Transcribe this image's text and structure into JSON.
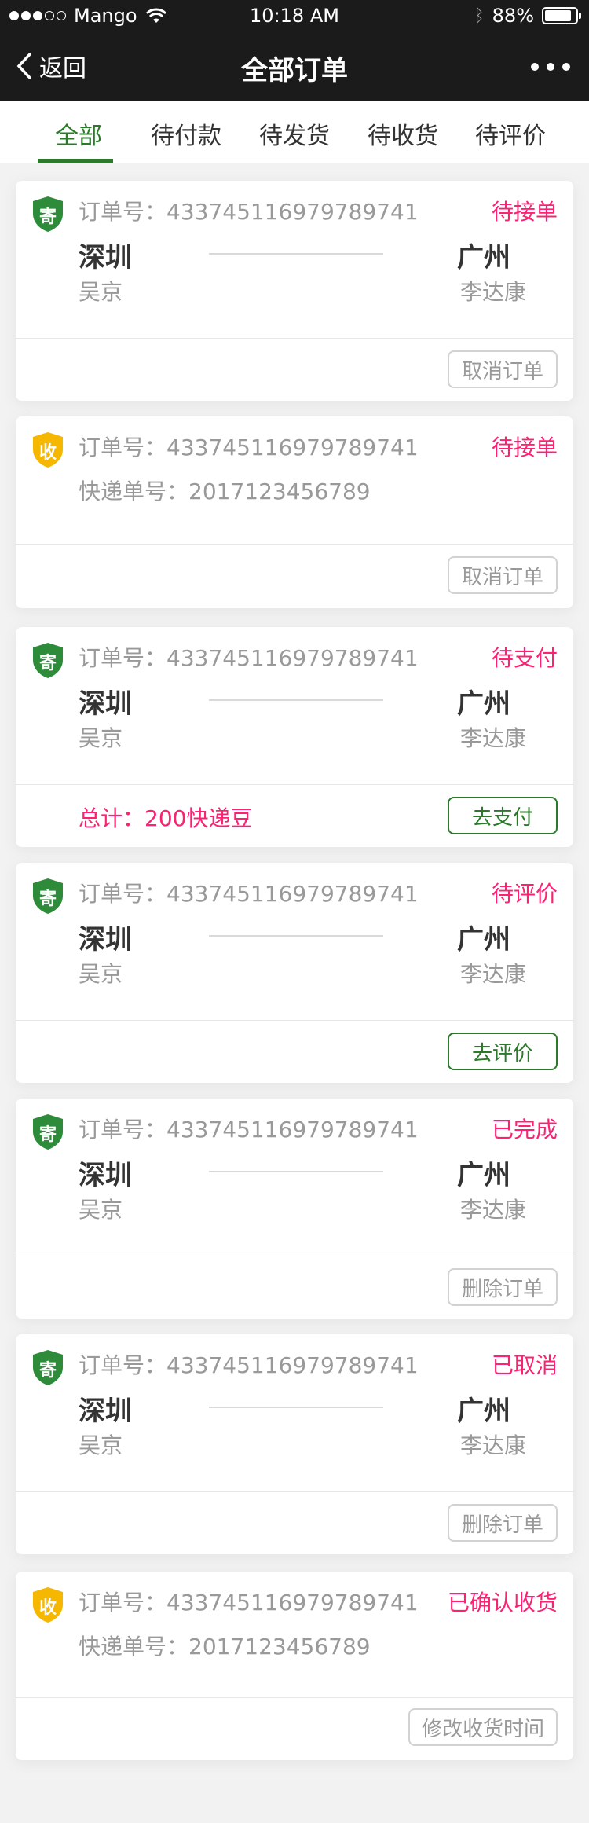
{
  "statusbar": {
    "carrier": "Mango",
    "time": "10:18 AM",
    "battery": "88%",
    "battery_level": 0.88,
    "bluetooth_icon": "bluetooth-icon"
  },
  "navbar": {
    "back_label": "返回",
    "title": "全部订单"
  },
  "tabs": [
    {
      "label": "全部",
      "active": true
    },
    {
      "label": "待付款"
    },
    {
      "label": "待发货"
    },
    {
      "label": "待收货"
    },
    {
      "label": "待评价"
    }
  ],
  "colors": {
    "accent_green": "#2a7a2a",
    "status_pink": "#FD2073",
    "badge_green": "#2e8b3a",
    "badge_yellow": "#f5b700"
  },
  "orders": [
    {
      "badge": "寄",
      "order_no": "订单号：433745116979789741",
      "status": "待接单",
      "from_city": "深圳",
      "from_name": "吴京",
      "to_city": "广州",
      "to_name": "李达康",
      "button": "取消订单"
    },
    {
      "badge": "收",
      "order_no": "订单号：433745116979789741",
      "status": "待接单",
      "express_no": "快递单号：2017123456789",
      "button": "取消订单"
    },
    {
      "badge": "寄",
      "order_no": "订单号：433745116979789741",
      "status": "待支付",
      "from_city": "深圳",
      "from_name": "吴京",
      "to_city": "广州",
      "to_name": "李达康",
      "total": "总计：200快递豆",
      "button": "去支付"
    },
    {
      "badge": "寄",
      "order_no": "订单号：433745116979789741",
      "status": "待评价",
      "from_city": "深圳",
      "from_name": "吴京",
      "to_city": "广州",
      "to_name": "李达康",
      "button": "去评价"
    },
    {
      "badge": "寄",
      "order_no": "订单号：433745116979789741",
      "status": "已完成",
      "from_city": "深圳",
      "from_name": "吴京",
      "to_city": "广州",
      "to_name": "李达康",
      "button": "删除订单"
    },
    {
      "badge": "寄",
      "order_no": "订单号：433745116979789741",
      "status": "已取消",
      "from_city": "深圳",
      "from_name": "吴京",
      "to_city": "广州",
      "to_name": "李达康",
      "button": "删除订单"
    },
    {
      "badge": "收",
      "order_no": "订单号：433745116979789741",
      "status": "已确认收货",
      "express_no": "快递单号：2017123456789",
      "button": "修改收货时间"
    }
  ]
}
